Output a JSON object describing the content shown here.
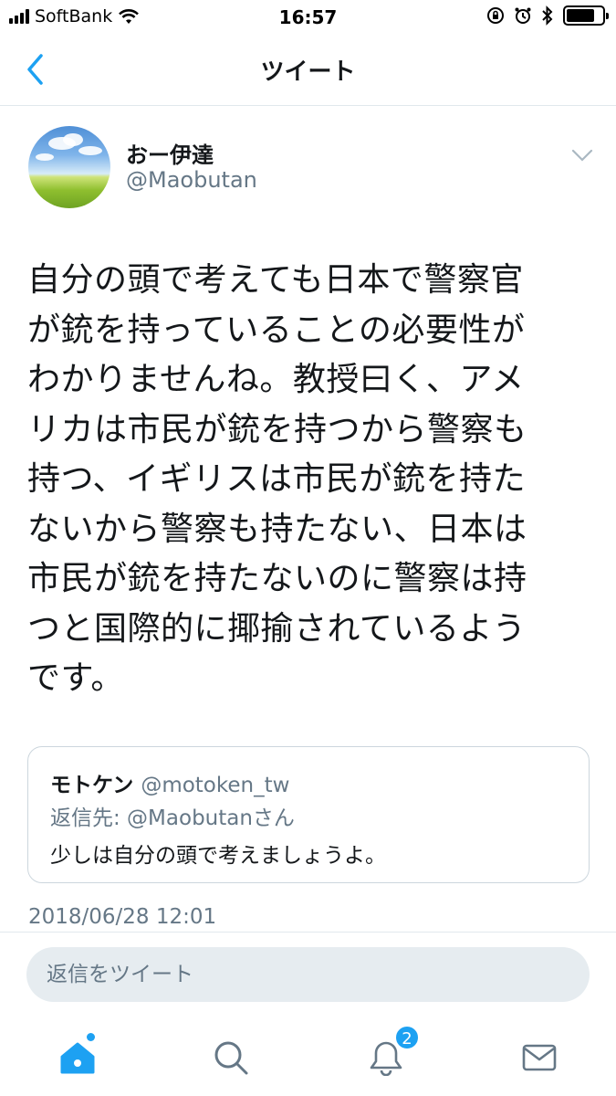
{
  "status_bar": {
    "carrier": "SoftBank",
    "time": "16:57",
    "battery_level": 0.8
  },
  "nav": {
    "title": "ツイート"
  },
  "tweet": {
    "display_name": "おー伊達",
    "username": "@Maobutan",
    "text_lines": [
      "自分の頭で考えても日本で警察官",
      "が銃を持っていることの必要性が",
      "わかりませんね。教授曰く、アメ",
      "リカは市民が銃を持つから警察も",
      "持つ、イギリスは市民が銃を持た",
      "ないから警察も持たない、日本は",
      "市民が銃を持たないのに警察は持",
      "つと国際的に揶揄されているよう",
      "です。"
    ],
    "timestamp": "2018/06/28 12:01"
  },
  "quote": {
    "name": "モトケン",
    "handle": "@motoken_tw",
    "reply_to": "返信先: @Maobutanさん",
    "text": "少しは自分の頭で考えましょうよ。"
  },
  "reply": {
    "placeholder": "返信をツイート"
  },
  "tab_bar": {
    "items": [
      "home-icon",
      "search-icon",
      "notifications-icon",
      "messages-icon"
    ],
    "notification_badge": "2"
  },
  "colors": {
    "accent": "#1da1f2",
    "secondary_text": "#657786",
    "border": "#e1e8ed"
  }
}
